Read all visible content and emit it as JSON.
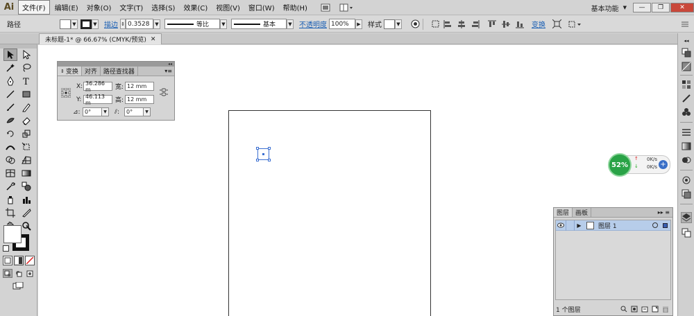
{
  "app": {
    "logo": "Ai"
  },
  "menu": {
    "items": [
      "文件(F)",
      "编辑(E)",
      "对象(O)",
      "文字(T)",
      "选择(S)",
      "效果(C)",
      "视图(V)",
      "窗口(W)",
      "帮助(H)"
    ],
    "workspace": "基本功能"
  },
  "control_bar": {
    "label": "路径",
    "stroke_link": "描边",
    "stroke_weight": "0.3528",
    "profile": "等比",
    "brush": "基本",
    "opacity_link": "不透明度",
    "opacity": "100%",
    "style_label": "样式",
    "transform_link": "变换"
  },
  "document": {
    "tab": "未标题-1* @ 66.67% (CMYK/预览)"
  },
  "transform_panel": {
    "tabs": [
      "变换",
      "对齐",
      "路径查找器"
    ],
    "x_label": "X:",
    "x_value": "36.286 m",
    "y_label": "Y:",
    "y_value": "46.113 m",
    "w_label": "宽:",
    "w_value": "12 mm",
    "h_label": "高:",
    "h_value": "12 mm",
    "rotate_value": "0°",
    "shear_value": "0°"
  },
  "network_widget": {
    "percent": "52%",
    "up": "0K/s",
    "down": "0K/s"
  },
  "layers_panel": {
    "tabs": [
      "图层",
      "画板"
    ],
    "layer_name": "图层 1",
    "footer": "1 个图层"
  }
}
